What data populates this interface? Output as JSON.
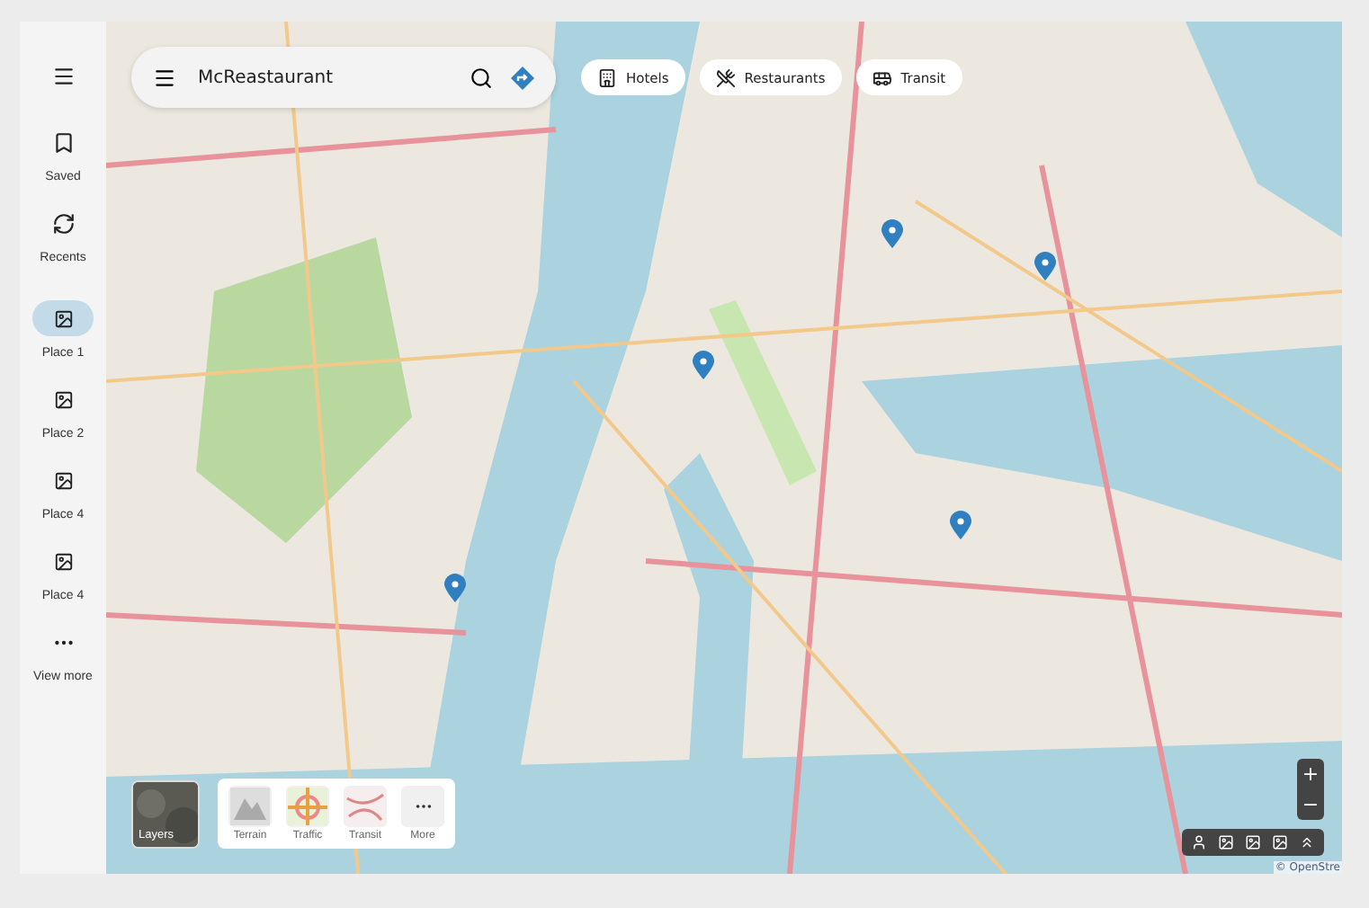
{
  "sidebar": {
    "items": [
      {
        "kind": "menu"
      },
      {
        "kind": "bookmark",
        "label": "Saved",
        "selected": false
      },
      {
        "kind": "refresh",
        "label": "Recents",
        "selected": false
      },
      {
        "kind": "place",
        "label": "Place 1",
        "selected": true
      },
      {
        "kind": "place",
        "label": "Place 2",
        "selected": false
      },
      {
        "kind": "place",
        "label": "Place 4",
        "selected": false
      },
      {
        "kind": "place",
        "label": "Place 4",
        "selected": false
      },
      {
        "kind": "more",
        "label": "View more",
        "selected": false
      }
    ]
  },
  "search": {
    "value": "McReastaurant"
  },
  "chips": [
    {
      "kind": "hotel",
      "label": "Hotels"
    },
    {
      "kind": "food",
      "label": "Restaurants"
    },
    {
      "kind": "bus",
      "label": "Transit"
    }
  ],
  "map": {
    "kind": "picture",
    "attribution": "© OpenStre"
  },
  "layers": {
    "label": "Layers",
    "options": [
      {
        "kind": "terrain",
        "label": "Terrain"
      },
      {
        "kind": "traffic",
        "label": "Traffic"
      },
      {
        "kind": "transit",
        "label": "Transit"
      },
      {
        "kind": "more",
        "label": "More"
      }
    ]
  },
  "controls": {
    "zoom_in": "+",
    "zoom_out": "−"
  }
}
